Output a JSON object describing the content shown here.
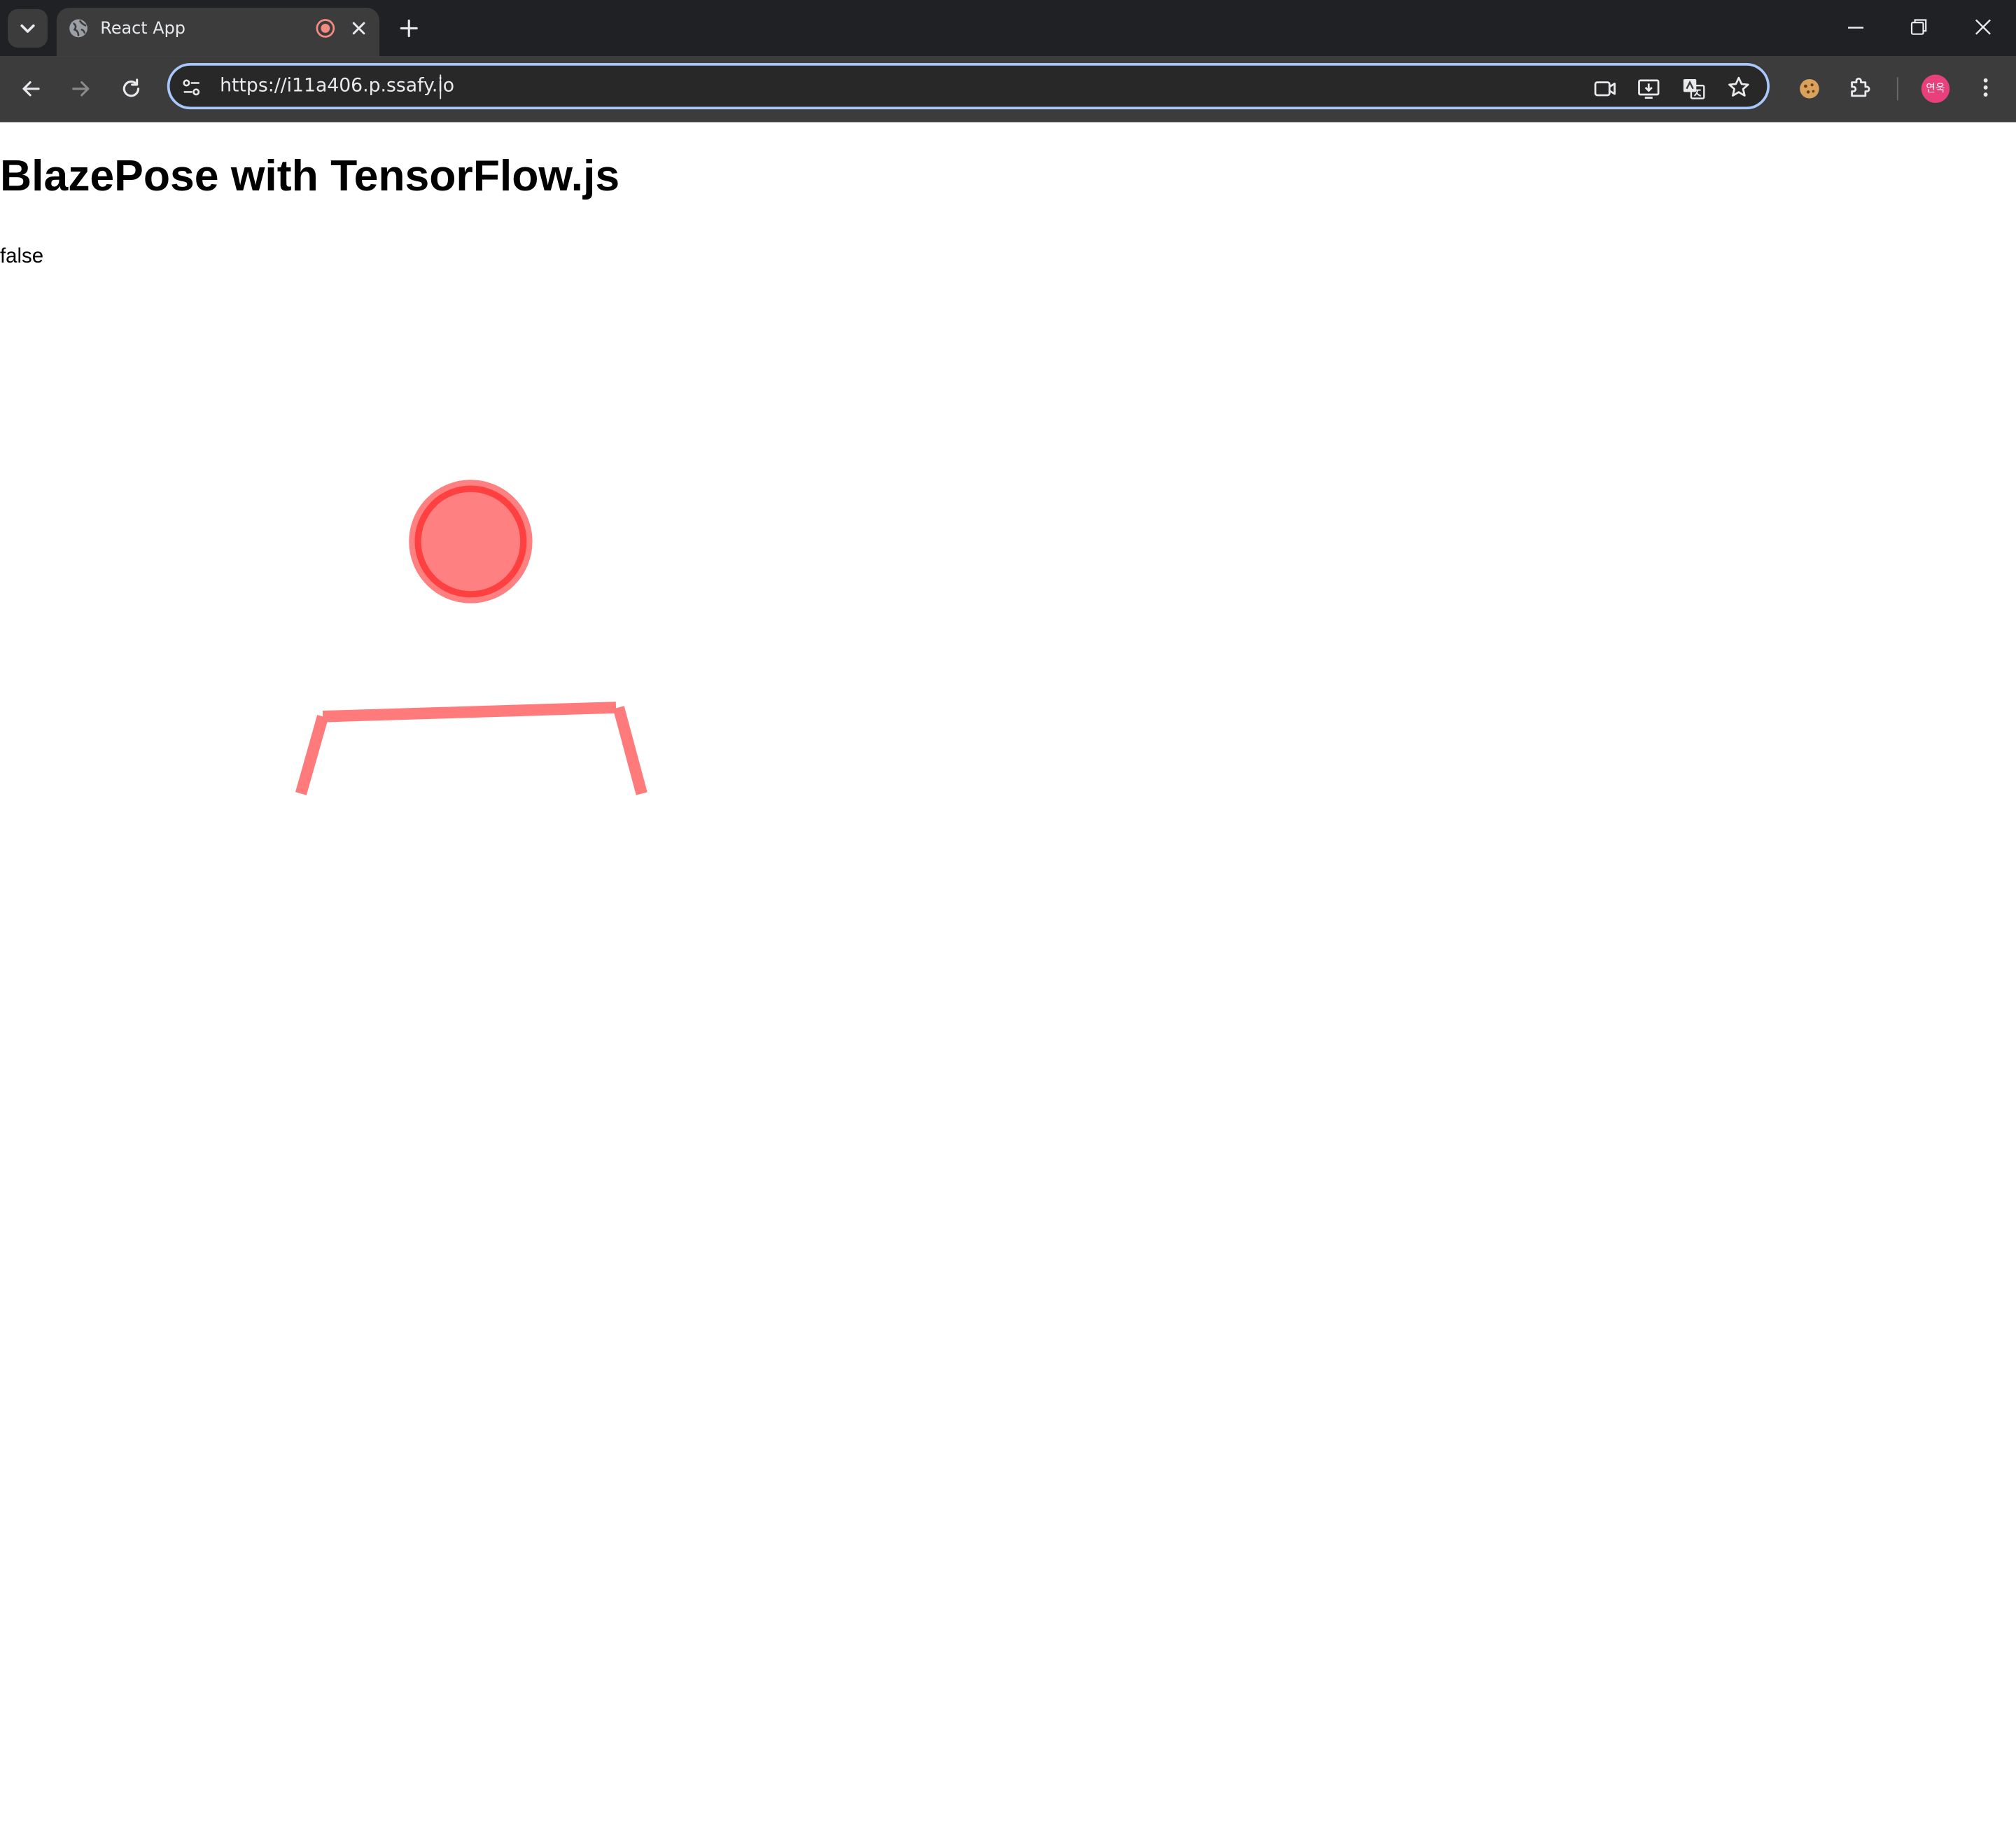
{
  "browser": {
    "tab_title": "React App",
    "url": "https://i11a406.p.ssafy.io",
    "profile_initials": "연욱"
  },
  "page": {
    "heading": "BlazePose with TensorFlow.js",
    "status": "false"
  },
  "colors": {
    "pose_stroke": "#ff7b7b",
    "keypoint_fill": "#ff8080",
    "keypoint_ring": "#ff4040"
  }
}
